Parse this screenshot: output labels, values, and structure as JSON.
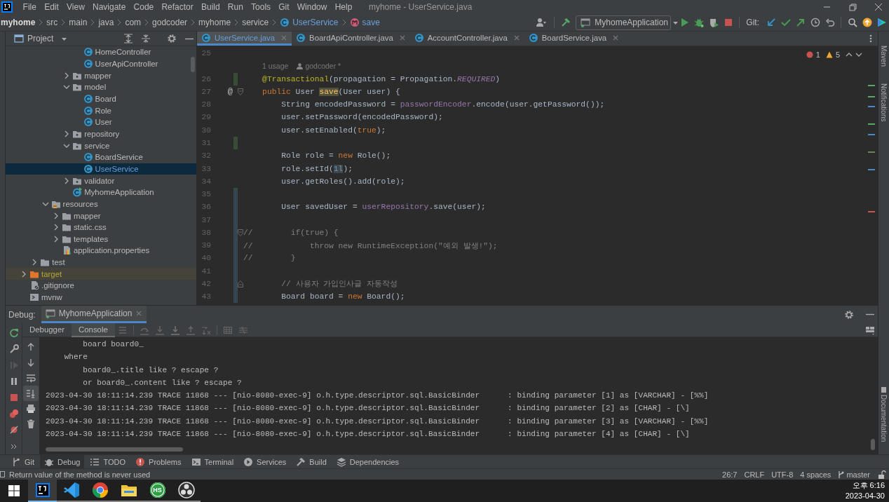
{
  "window": {
    "title": "myhome - UserService.java"
  },
  "menu": [
    "File",
    "Edit",
    "View",
    "Navigate",
    "Code",
    "Refactor",
    "Build",
    "Run",
    "Tools",
    "Git",
    "Window",
    "Help"
  ],
  "breadcrumb": [
    {
      "label": "myhome",
      "kind": "project"
    },
    {
      "label": "src",
      "kind": "dir"
    },
    {
      "label": "main",
      "kind": "dir"
    },
    {
      "label": "java",
      "kind": "dir"
    },
    {
      "label": "com",
      "kind": "dir"
    },
    {
      "label": "godcoder",
      "kind": "dir"
    },
    {
      "label": "myhome",
      "kind": "dir"
    },
    {
      "label": "service",
      "kind": "dir"
    },
    {
      "label": "UserService",
      "kind": "class"
    },
    {
      "label": "save",
      "kind": "method"
    }
  ],
  "toolbar": {
    "run_config": "MyhomeApplication",
    "git_label": "Git:"
  },
  "project": {
    "title": "Project",
    "tree": [
      {
        "children": [
          {
            "children": [
              {
                "children": [
                  {
                    "children": [
                      {
                        "children": [
                          {
                            "label": "HomeController",
                            "kind": "class",
                            "selected": false
                          },
                          {
                            "label": "UserApiController",
                            "kind": "class",
                            "selected": false
                          }
                        ]
                      },
                      {
                        "label": "mapper",
                        "kind": "package",
                        "expanded": false,
                        "selected": false
                      },
                      {
                        "label": "model",
                        "kind": "package",
                        "expanded": true,
                        "selected": false,
                        "children": [
                          {
                            "label": "Board",
                            "kind": "class",
                            "selected": false
                          },
                          {
                            "label": "Role",
                            "kind": "class",
                            "selected": false
                          },
                          {
                            "label": "User",
                            "kind": "class",
                            "selected": false
                          }
                        ]
                      },
                      {
                        "label": "repository",
                        "kind": "package",
                        "expanded": false,
                        "selected": false
                      },
                      {
                        "label": "service",
                        "kind": "package",
                        "expanded": true,
                        "selected": false,
                        "children": [
                          {
                            "label": "BoardService",
                            "kind": "class",
                            "selected": false
                          },
                          {
                            "label": "UserService",
                            "kind": "class",
                            "selected": true
                          }
                        ]
                      },
                      {
                        "label": "validator",
                        "kind": "package",
                        "expanded": false,
                        "selected": false
                      },
                      {
                        "label": "MyhomeApplication",
                        "kind": "app-class",
                        "selected": false
                      }
                    ]
                  }
                ]
              },
              {
                "label": "resources",
                "kind": "resources-folder",
                "expanded": true,
                "selected": false,
                "children": [
                  {
                    "label": "mapper",
                    "kind": "folder",
                    "expanded": false,
                    "selected": false
                  },
                  {
                    "label": "static.css",
                    "kind": "folder",
                    "expanded": false,
                    "selected": false
                  },
                  {
                    "label": "templates",
                    "kind": "folder",
                    "expanded": false,
                    "selected": false
                  },
                  {
                    "label": "application.properties",
                    "kind": "properties-file",
                    "selected": false
                  }
                ]
              }
            ]
          },
          {
            "label": "test",
            "kind": "folder",
            "expanded": false,
            "selected": false
          }
        ]
      },
      {
        "label": "target",
        "kind": "excluded-folder",
        "expanded": false,
        "selected": false
      },
      {
        "label": ".gitignore",
        "kind": "ignore-file",
        "selected": false
      },
      {
        "label": "mvnw",
        "kind": "script-file",
        "selected": false
      }
    ]
  },
  "editor": {
    "tabs": [
      {
        "label": "UserService.java",
        "selected": true
      },
      {
        "label": "BoardApiController.java",
        "selected": false
      },
      {
        "label": "AccountController.java",
        "selected": false
      },
      {
        "label": "BoardService.java",
        "selected": false
      }
    ],
    "problems": {
      "errors": "1",
      "warnings": "5"
    },
    "lines": [
      {
        "kind": "code",
        "number": "25"
      },
      {
        "kind": "inlay",
        "usages": "1 usage",
        "author": "godcoder *"
      },
      {
        "kind": "code",
        "number": "26",
        "color": "#384c38",
        "tokens": [
          {
            "kind": "annotation",
            "text": "    @Transactional"
          },
          {
            "kind": "plain",
            "text": "(propagation = Propagation."
          },
          {
            "kind": "constant",
            "text": "REQUIRED"
          },
          {
            "kind": "plain",
            "text": ")"
          }
        ]
      },
      {
        "kind": "code",
        "number": "27",
        "gutter_mark": "@",
        "fold_start": true,
        "tokens": [
          {
            "kind": "keyword",
            "text": "    public "
          },
          {
            "kind": "plain",
            "text": "User "
          },
          {
            "kind": "method-highlight",
            "text": "save"
          },
          {
            "kind": "plain",
            "text": "(User user) {"
          }
        ]
      },
      {
        "kind": "code",
        "number": "28",
        "tokens": [
          {
            "kind": "plain",
            "text": "        String encodedPassword = "
          },
          {
            "kind": "field",
            "text": "passwordEncoder"
          },
          {
            "kind": "plain",
            "text": ".encode(user.getPassword());"
          }
        ]
      },
      {
        "kind": "code",
        "number": "29",
        "tokens": [
          {
            "kind": "plain",
            "text": "        user.setPassword(encodedPassword);"
          }
        ]
      },
      {
        "kind": "code",
        "number": "30",
        "tokens": [
          {
            "kind": "plain",
            "text": "        user.setEnabled("
          },
          {
            "kind": "keyword",
            "text": "true"
          },
          {
            "kind": "plain",
            "text": ");"
          }
        ]
      },
      {
        "kind": "code",
        "number": "31",
        "color": "#384c38"
      },
      {
        "kind": "code",
        "number": "32",
        "tokens": [
          {
            "kind": "plain",
            "text": "        Role role = "
          },
          {
            "kind": "keyword",
            "text": "new "
          },
          {
            "kind": "plain",
            "text": "Role();"
          }
        ]
      },
      {
        "kind": "code",
        "number": "33",
        "tokens": [
          {
            "kind": "plain",
            "text": "        role.setId("
          },
          {
            "kind": "number-highlight",
            "text": "1l"
          },
          {
            "kind": "plain",
            "text": ");"
          }
        ]
      },
      {
        "kind": "code",
        "number": "34",
        "tokens": [
          {
            "kind": "plain",
            "text": "        user.getRoles().add(role);"
          }
        ]
      },
      {
        "kind": "code",
        "number": "35",
        "color": "#374752"
      },
      {
        "kind": "code",
        "number": "36",
        "color": "#374752",
        "tokens": [
          {
            "kind": "plain",
            "text": "        User savedUser = "
          },
          {
            "kind": "field",
            "text": "userRepository"
          },
          {
            "kind": "plain",
            "text": ".save(user);"
          }
        ]
      },
      {
        "kind": "code",
        "number": "37",
        "color": "#374752"
      },
      {
        "kind": "code",
        "number": "38",
        "color": "#374752",
        "fold_start": true,
        "tokens": [
          {
            "kind": "comment",
            "text": "//        if(true) {"
          }
        ]
      },
      {
        "kind": "code",
        "number": "39",
        "color": "#374752",
        "tokens": [
          {
            "kind": "comment",
            "text": "//            throw new RuntimeException(\"예외 발생!\");"
          }
        ]
      },
      {
        "kind": "code",
        "number": "40",
        "color": "#374752",
        "tokens": [
          {
            "kind": "comment",
            "text": "//        }"
          }
        ]
      },
      {
        "kind": "code",
        "number": "41",
        "color": "#374752"
      },
      {
        "kind": "code",
        "number": "42",
        "color": "#374752",
        "fold_end": true,
        "tokens": [
          {
            "kind": "comment",
            "text": "        // 사용자 가입인사글 자동작성"
          }
        ]
      },
      {
        "kind": "code",
        "number": "43",
        "color": "#374752",
        "tokens": [
          {
            "kind": "plain",
            "text": "        Board board = "
          },
          {
            "kind": "keyword",
            "text": "new "
          },
          {
            "kind": "plain",
            "text": "Board();"
          }
        ]
      }
    ]
  },
  "side_panels": {
    "top": [
      "Maven",
      "Notifications"
    ],
    "bottom": [
      "Documentation"
    ]
  },
  "debug": {
    "label": "Debug:",
    "sessions": [
      {
        "label": "MyhomeApplication",
        "selected": true
      }
    ],
    "tabs": [
      {
        "label": "Debugger",
        "selected": false
      },
      {
        "label": "Console",
        "selected": true
      }
    ],
    "console": [
      "        board board0_",
      "    where",
      "        board0_.title like ? escape ?",
      "        or board0_.content like ? escape ?",
      "2023-04-30 18:11:14.239 TRACE 11868 --- [nio-8080-exec-9] o.h.type.descriptor.sql.BasicBinder      : binding parameter [1] as [VARCHAR] - [%%]",
      "2023-04-30 18:11:14.239 TRACE 11868 --- [nio-8080-exec-9] o.h.type.descriptor.sql.BasicBinder      : binding parameter [2] as [CHAR] - [\\]",
      "2023-04-30 18:11:14.239 TRACE 11868 --- [nio-8080-exec-9] o.h.type.descriptor.sql.BasicBinder      : binding parameter [3] as [VARCHAR] - [%%]",
      "2023-04-30 18:11:14.239 TRACE 11868 --- [nio-8080-exec-9] o.h.type.descriptor.sql.BasicBinder      : binding parameter [4] as [CHAR] - [\\]"
    ]
  },
  "tool_windows": [
    {
      "label": "Git",
      "kind": "git",
      "selected": false
    },
    {
      "label": "Debug",
      "kind": "debug",
      "selected": true
    },
    {
      "label": "TODO",
      "kind": "todo",
      "selected": false
    },
    {
      "label": "Problems",
      "kind": "problems",
      "selected": false
    },
    {
      "label": "Terminal",
      "kind": "terminal",
      "selected": false
    },
    {
      "label": "Services",
      "kind": "services",
      "selected": false
    },
    {
      "label": "Build",
      "kind": "build",
      "selected": false
    },
    {
      "label": "Dependencies",
      "kind": "dependencies",
      "selected": false
    }
  ],
  "status_bar": {
    "message": "Return value of the method is never used",
    "items": [
      {
        "kind": "position",
        "text": "26:7"
      },
      {
        "kind": "line-separator",
        "text": "CRLF"
      },
      {
        "kind": "encoding",
        "text": "UTF-8"
      },
      {
        "kind": "indent",
        "text": "4 spaces"
      },
      {
        "kind": "branch",
        "text": "master"
      }
    ]
  },
  "taskbar": {
    "apps": [
      {
        "kind": "intellij",
        "selected": true
      },
      {
        "kind": "vscode",
        "selected": false
      },
      {
        "kind": "chrome",
        "selected": false
      },
      {
        "kind": "explorer",
        "selected": false
      },
      {
        "kind": "hs",
        "badge": "HS",
        "selected": false
      },
      {
        "kind": "obs",
        "selected": false
      }
    ],
    "time": "오후 6:16",
    "date": "2023-04-30"
  }
}
